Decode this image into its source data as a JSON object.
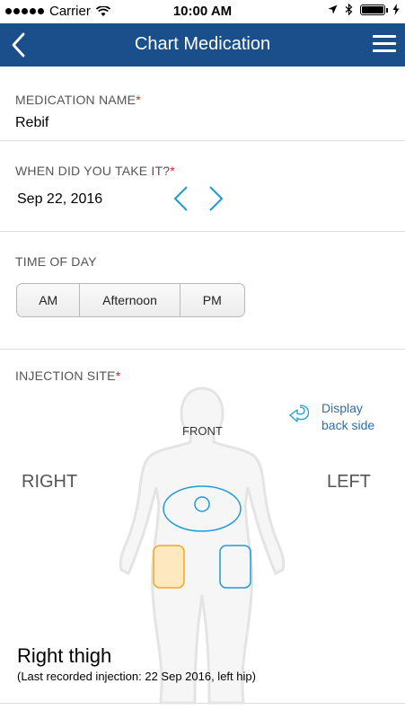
{
  "status_bar": {
    "carrier": "Carrier",
    "time": "10:00 AM",
    "battery_level": 1.0
  },
  "nav": {
    "title": "Chart Medication",
    "back_icon": "chevron-left-icon",
    "menu_icon": "hamburger-menu-icon",
    "background_color": "#1a4f8b"
  },
  "medication": {
    "label": "MEDICATION NAME",
    "required_mark": "*",
    "value": "Rebif"
  },
  "when_taken": {
    "label": "WHEN DID YOU TAKE IT?",
    "required_mark": "*",
    "date": "Sep 22, 2016"
  },
  "time_of_day": {
    "label": "TIME OF DAY",
    "options": [
      "AM",
      "Afternoon",
      "PM"
    ]
  },
  "injection_site": {
    "label": "INJECTION SITE",
    "required_mark": "*",
    "view_label": "FRONT",
    "right_label": "RIGHT",
    "left_label": "LEFT",
    "display_back": "Display back side",
    "display_back_line1": "Display",
    "display_back_line2": "back side",
    "selected_site": "Right thigh",
    "last_recorded": "(Last recorded injection: 22 Sep 2016, left hip)",
    "selected_color": "#f5a623",
    "site_color": "#1e9bd7"
  }
}
